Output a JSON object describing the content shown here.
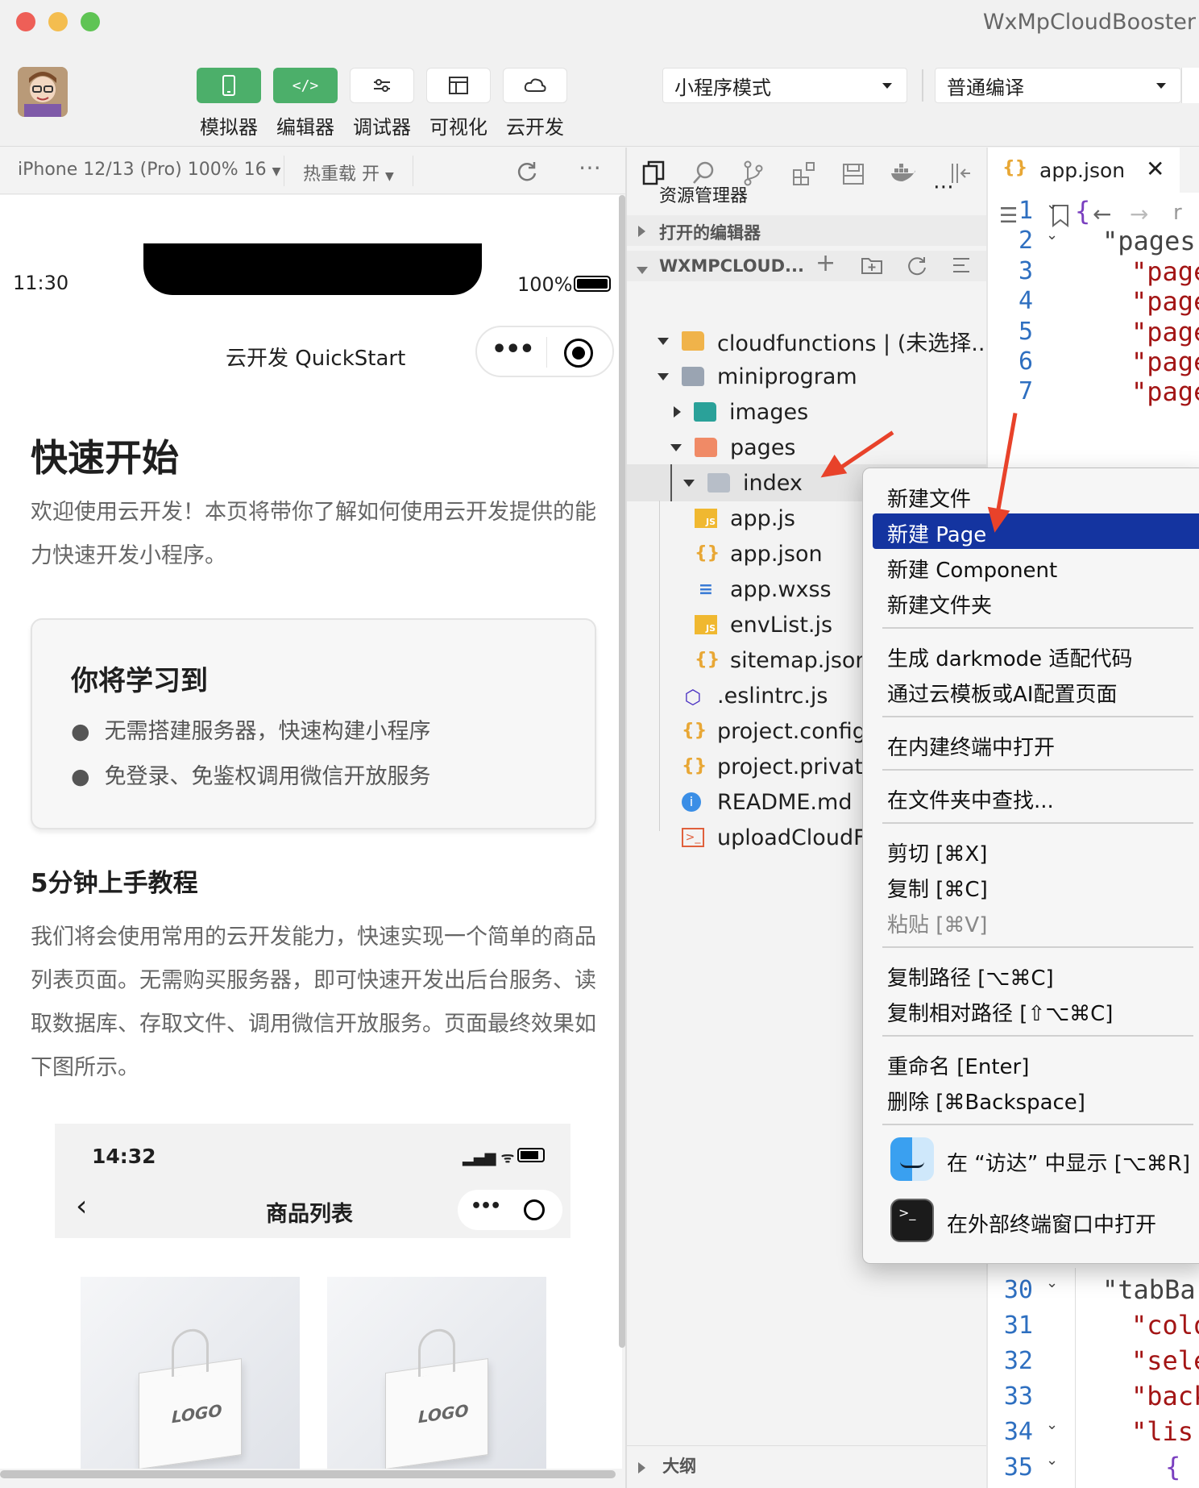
{
  "window": {
    "title": "WxMpCloudBooster"
  },
  "toolbar": {
    "tools": [
      {
        "icon": "phone-icon",
        "label": "模拟器"
      },
      {
        "icon": "code-icon",
        "label": "编辑器"
      },
      {
        "icon": "debug-icon",
        "label": "调试器"
      },
      {
        "icon": "layout-icon",
        "label": "可视化"
      },
      {
        "icon": "cloud-icon",
        "label": "云开发"
      }
    ],
    "mode_select": "小程序模式",
    "compile_select": "普通编译"
  },
  "simulator": {
    "device": "iPhone 12/13 (Pro) 100% 16",
    "hot_reload": "热重载 开",
    "status_time": "11:30",
    "battery": "100%",
    "nav_title": "云开发 QuickStart",
    "heading": "快速开始",
    "intro": "欢迎使用云开发！本页将带你了解如何使用云开发提供的能力快速开发小程序。",
    "card_title": "你将学习到",
    "card_items": [
      "无需搭建服务器，快速构建小程序",
      "免登录、免鉴权调用微信开放服务"
    ],
    "tutorial_title": "5分钟上手教程",
    "tutorial_text": "我们将会使用常用的云开发能力，快速实现一个简单的商品列表页面。无需购买服务器，即可快速开发出后台服务、读取数据库、存取文件、调用微信开放服务。页面最终效果如下图所示。",
    "mock_time": "14:32",
    "mock_title": "商品列表",
    "product_logo": "LOGO"
  },
  "explorer": {
    "title": "资源管理器",
    "open_editors": "打开的编辑器",
    "project": "WXMPCLOUD...",
    "outline": "大纲",
    "tree": [
      "cloudfunctions | (未选择...",
      "miniprogram",
      "images",
      "pages",
      "index",
      "app.js",
      "app.json",
      "app.wxss",
      "envList.js",
      "sitemap.json",
      ".eslintrc.js",
      "project.config",
      "project.private",
      "README.md",
      "uploadCloudF"
    ]
  },
  "editor": {
    "tab": "app.json",
    "lines_top": [
      "1",
      "2",
      "3",
      "4",
      "5",
      "6",
      "7"
    ],
    "code_top": [
      "{",
      "\"pages\"",
      "\"page",
      "\"page",
      "\"page",
      "\"page",
      "\"page"
    ],
    "lines_bottom": [
      "30",
      "31",
      "32",
      "33",
      "34",
      "35"
    ],
    "code_bottom": [
      "\"tabBa",
      "\"colo",
      "\"sele",
      "\"back",
      "\"lis",
      "{"
    ]
  },
  "context_menu": {
    "groups": [
      [
        "新建文件",
        "新建 Page",
        "新建 Component",
        "新建文件夹"
      ],
      [
        "生成 darkmode 适配代码",
        "通过云模板或AI配置页面"
      ],
      [
        "在内建终端中打开"
      ],
      [
        "在文件夹中查找..."
      ],
      [
        "剪切 [⌘X]",
        "复制 [⌘C]",
        "粘贴 [⌘V]"
      ],
      [
        "复制路径 [⌥⌘C]",
        "复制相对路径 [⇧⌥⌘C]"
      ],
      [
        "重命名 [Enter]",
        "删除 [⌘Backspace]"
      ],
      [
        "在 “访达” 中显示 [⌥⌘R]",
        "在外部终端窗口中打开"
      ]
    ]
  },
  "colors": {
    "accent_green": "#4caf6a",
    "menu_highlight": "#1434a0",
    "annotation_arrow": "#e8422a"
  }
}
